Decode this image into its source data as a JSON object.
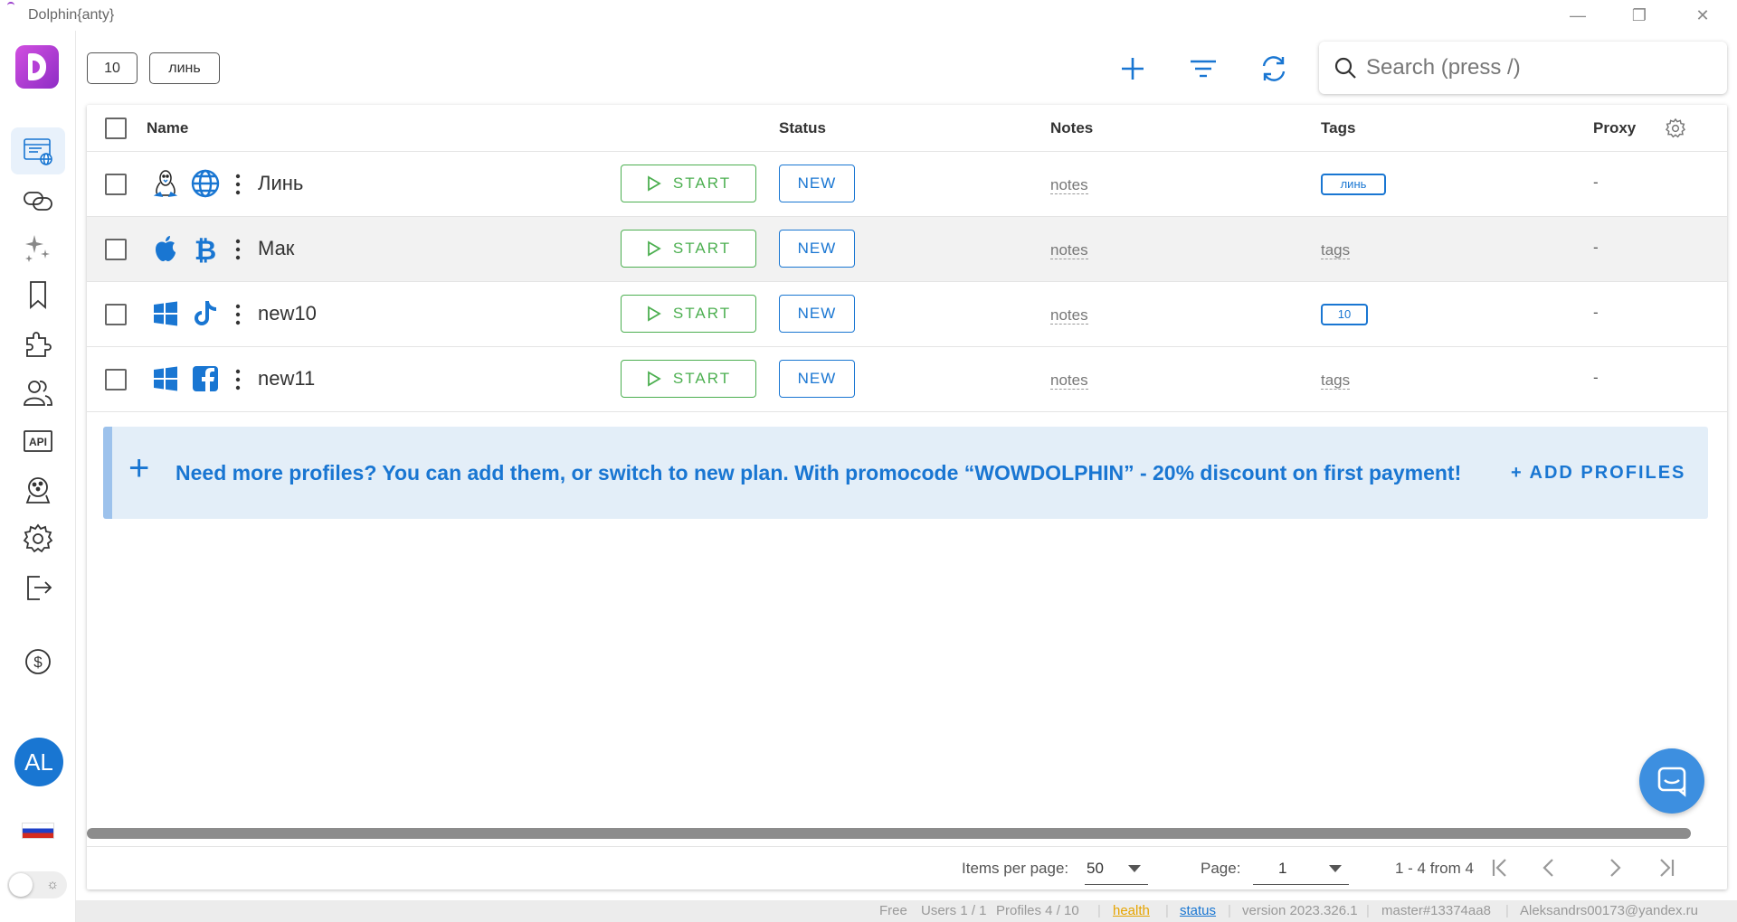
{
  "window": {
    "title": "Dolphin{anty}",
    "minimize": "—",
    "restore": "❐",
    "close": "✕"
  },
  "filters": {
    "chip1": "10",
    "chip2": "линь"
  },
  "search": {
    "placeholder": "Search (press /)"
  },
  "table": {
    "columns": {
      "name": "Name",
      "status": "Status",
      "notes": "Notes",
      "tags": "Tags",
      "proxy": "Proxy"
    },
    "rows": [
      {
        "name": "Линь",
        "os": "linux-icon",
        "site": "globe-icon",
        "start": "START",
        "status": "NEW",
        "notes": "notes",
        "tag": "линь",
        "tags_placeholder": "",
        "proxy": "-"
      },
      {
        "name": "Мак",
        "os": "apple-icon",
        "site": "bitcoin-icon",
        "start": "START",
        "status": "NEW",
        "notes": "notes",
        "tag": "",
        "tags_placeholder": "tags",
        "proxy": "-"
      },
      {
        "name": "new10",
        "os": "windows-icon",
        "site": "tiktok-icon",
        "start": "START",
        "status": "NEW",
        "notes": "notes",
        "tag": "10",
        "tags_placeholder": "",
        "proxy": "-"
      },
      {
        "name": "new11",
        "os": "windows-icon",
        "site": "facebook-icon",
        "start": "START",
        "status": "NEW",
        "notes": "notes",
        "tag": "",
        "tags_placeholder": "tags",
        "proxy": "-"
      }
    ]
  },
  "promo": {
    "plus": "+",
    "message": "Need more profiles? You can add them, or switch to new plan. With promocode “WOWDOLPHIN” - 20% discount on first payment!",
    "action": "+ ADD PROFILES"
  },
  "pager": {
    "items_label": "Items per page:",
    "items_value": "50",
    "page_label": "Page:",
    "page_value": "1",
    "range": "1 - 4 from 4"
  },
  "sidebar": {
    "avatar": "AL"
  },
  "statusbar": {
    "plan": "Free",
    "users": "Users 1 / 1",
    "profiles": "Profiles 4 / 10",
    "health": "health",
    "status": "status",
    "version": "version 2023.326.1",
    "build": "master#13374aa8",
    "email": "Aleksandrs00173@yandex.ru"
  },
  "colors": {
    "primary": "#1976d2",
    "start": "#4caf50",
    "brand": "#b53fd6",
    "promo_bg": "#e3eef8"
  }
}
